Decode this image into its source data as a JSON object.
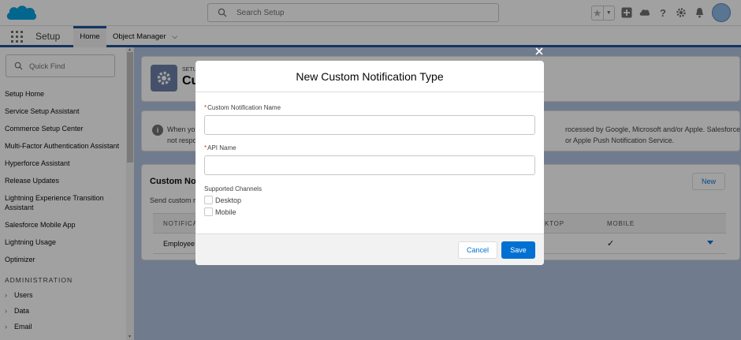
{
  "global": {
    "search_placeholder": "Search Setup"
  },
  "nav": {
    "app_name": "Setup",
    "tabs": [
      {
        "label": "Home"
      },
      {
        "label": "Object Manager"
      }
    ]
  },
  "sidebar": {
    "quick_find_placeholder": "Quick Find",
    "items": [
      "Setup Home",
      "Service Setup Assistant",
      "Commerce Setup Center",
      "Multi-Factor Authentication Assistant",
      "Hyperforce Assistant",
      "Release Updates",
      "Lightning Experience Transition Assistant",
      "Salesforce Mobile App",
      "Lightning Usage",
      "Optimizer"
    ],
    "section_heading": "ADMINISTRATION",
    "sub_items": [
      "Users",
      "Data",
      "Email"
    ]
  },
  "page_header": {
    "caption": "SETUP",
    "title": "Cu"
  },
  "info_box": {
    "line1_left": "When yo",
    "line1_right": "rocessed by Google, Microsoft and/or Apple. Salesforce is",
    "line2_left": "not respo",
    "line2_right": "or Apple Push Notification Service."
  },
  "list_card": {
    "title": "Custom No",
    "subtitle": "Send custom n",
    "new_button": "New",
    "columns": [
      "NOTIFICA",
      "KTOP",
      "MOBILE"
    ],
    "rows": [
      {
        "name": "Employee",
        "mobile_check": "✓"
      }
    ]
  },
  "modal": {
    "title": "New Custom Notification Type",
    "name_label": "Custom Notification Name",
    "name_value": "",
    "api_label": "API Name",
    "api_value": "",
    "channels_label": "Supported Channels",
    "channels": [
      "Desktop",
      "Mobile"
    ],
    "cancel_label": "Cancel",
    "save_label": "Save"
  },
  "colors": {
    "brand_blue": "#0070d2",
    "nav_accent": "#1b5297",
    "required": "#c23934",
    "salesforce_cloud": "#00a1e0"
  }
}
